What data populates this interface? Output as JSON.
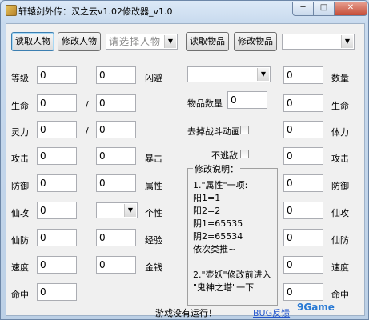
{
  "window": {
    "title": "轩辕剑外传：汉之云v1.02修改器_v1.0",
    "min_glyph": "─",
    "max_glyph": "□",
    "close_glyph": "✕"
  },
  "toolbar": {
    "read_character": "读取人物",
    "modify_character": "修改人物",
    "character_placeholder": "请选择人物",
    "read_item": "读取物品",
    "modify_item": "修改物品",
    "item_select_value": ""
  },
  "left_stats": [
    {
      "label": "等级",
      "value": "0",
      "value2": "0",
      "right_label": "闪避"
    },
    {
      "label": "生命",
      "value": "0",
      "sep": "/",
      "value2": "0"
    },
    {
      "label": "灵力",
      "value": "0",
      "sep": "/",
      "value2": "0"
    },
    {
      "label": "攻击",
      "value": "0",
      "value2": "0",
      "right_label": "暴击"
    },
    {
      "label": "防御",
      "value": "0",
      "value2": "0",
      "right_label": "属性"
    },
    {
      "label": "仙攻",
      "value": "0",
      "value2": "",
      "right_label": "个性"
    },
    {
      "label": "仙防",
      "value": "0",
      "value2": "0",
      "right_label": "经验"
    },
    {
      "label": "速度",
      "value": "0",
      "value2": "0",
      "right_label": "金钱"
    },
    {
      "label": "命中",
      "value": "0"
    }
  ],
  "item_panel": {
    "item_select_value": "",
    "quantity_label": "物品数量",
    "quantity_value": "0",
    "remove_anim_label": "去掉战斗动画",
    "no_escape_label": "不逃敌"
  },
  "notes": {
    "title": "修改说明：",
    "lines": [
      "1.\"属性\"一项:",
      "阳1=1",
      "阳2=2",
      "阴1=65535",
      "阴2=65534",
      "依次类推~",
      "",
      "2.\"壶妖\"修改前进入",
      "\"鬼神之塔\"一下"
    ]
  },
  "right_stats": [
    {
      "label": "数量",
      "value": "0"
    },
    {
      "label": "生命",
      "value": "0"
    },
    {
      "label": "体力",
      "value": "0"
    },
    {
      "label": "攻击",
      "value": "0"
    },
    {
      "label": "防御",
      "value": "0"
    },
    {
      "label": "仙攻",
      "value": "0"
    },
    {
      "label": "仙防",
      "value": "0"
    },
    {
      "label": "速度",
      "value": "0"
    },
    {
      "label": "命中",
      "value": "0"
    }
  ],
  "status": {
    "game_status": "游戏没有运行！",
    "bug_feedback": "BUG反馈",
    "watermark": "9Game"
  }
}
